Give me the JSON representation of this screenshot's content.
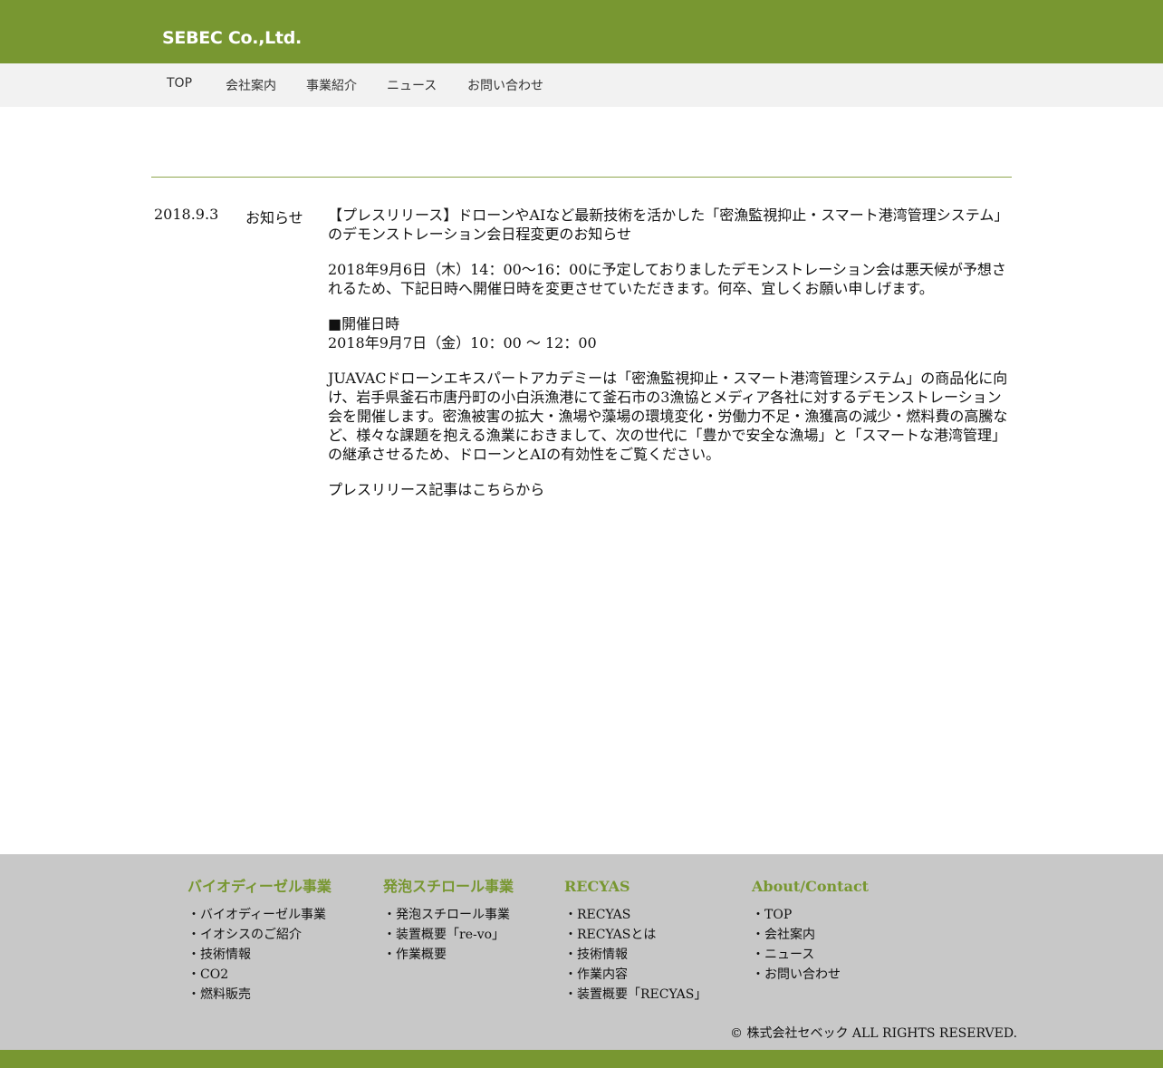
{
  "header": {
    "logo": "SEBEC Co.,Ltd."
  },
  "nav": [
    "TOP",
    "会社案内",
    "事業紹介",
    "ニュース",
    "お問い合わせ"
  ],
  "news": {
    "date": "2018.9.3",
    "category": "お知らせ",
    "title": "【プレスリリース】ドローンやAIなど最新技術を活かした「密漁監視抑止・スマート港湾管理システム」のデモンストレーション会日程変更のお知らせ",
    "para1": "2018年9月6日（木）14：00～16：00に予定しておりましたデモンストレーション会は悪天候が予想されるため、下記日時へ開催日時を変更させていただきます。何卒、宜しくお願い申しげます。",
    "schedule_label": "■開催日時",
    "schedule_value": "2018年9月7日（金）10：00 ～ 12：00",
    "para2": "JUAVACドローンエキスパートアカデミーは「密漁監視抑止・スマート港湾管理システム」の商品化に向け、岩手県釜石市唐丹町の小白浜漁港にて釜石市の3漁協とメディア各社に対するデモンストレーション会を開催します。密漁被害の拡大・漁場や藻場の環境変化・労働力不足・漁獲高の減少・燃料費の高騰など、様々な課題を抱える漁業におきまして、次の世代に「豊かで安全な漁場」と「スマートな港湾管理」の継承させるため、ドローンとAIの有効性をご覧ください。",
    "link": "プレスリリース記事はこちらから"
  },
  "footer": {
    "columns": [
      {
        "title": "バイオディーゼル事業",
        "items": [
          "・バイオディーゼル事業",
          "・イオシスのご紹介",
          "・技術情報",
          "・CO2",
          "・燃料販売"
        ]
      },
      {
        "title": "発泡スチロール事業",
        "items": [
          "・発泡スチロール事業",
          "・装置概要「re-vo」",
          "・作業概要"
        ]
      },
      {
        "title": "RECYAS",
        "items": [
          "・RECYAS",
          "・RECYASとは",
          "・技術情報",
          "・作業内容",
          "・装置概要「RECYAS」"
        ]
      },
      {
        "title": "About/Contact",
        "items": [
          "・TOP",
          "・会社案内",
          "・ニュース",
          "・お問い合わせ"
        ]
      }
    ],
    "copyright": "© 株式会社セベック ALL RIGHTS RESERVED."
  },
  "colors": {
    "brand_green": "#789731",
    "nav_bg": "#f2f2f2",
    "footer_bg": "#c8c8c8"
  }
}
